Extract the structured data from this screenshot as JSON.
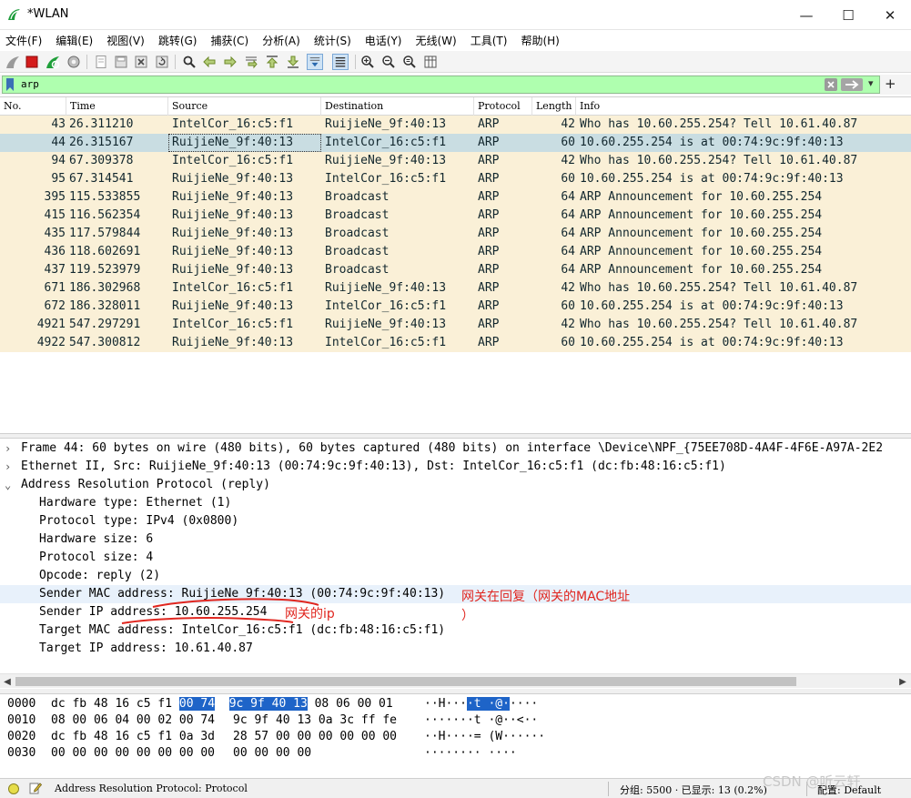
{
  "window": {
    "title": "*WLAN",
    "controls": {
      "minimize": "—",
      "maximize": "☐",
      "close": "✕"
    }
  },
  "menu": [
    "文件(F)",
    "编辑(E)",
    "视图(V)",
    "跳转(G)",
    "捕获(C)",
    "分析(A)",
    "统计(S)",
    "电话(Y)",
    "无线(W)",
    "工具(T)",
    "帮助(H)"
  ],
  "toolbar": {
    "icons": [
      "shark-fin-start-icon",
      "stop-capture-icon",
      "restart-capture-icon",
      "capture-options-icon",
      "open-file-icon",
      "save-file-icon",
      "close-file-icon",
      "reload-file-icon",
      "find-packet-icon",
      "go-back-icon",
      "go-forward-icon",
      "go-to-packet-icon",
      "go-first-icon",
      "go-last-icon",
      "auto-scroll-icon",
      "colorize-icon",
      "zoom-in-icon",
      "zoom-out-icon",
      "zoom-normal-icon",
      "resize-columns-icon"
    ]
  },
  "filter": {
    "value": "arp",
    "dropdown": "▾",
    "add": "+"
  },
  "packet_list": {
    "columns": [
      "No.",
      "Time",
      "Source",
      "Destination",
      "Protocol",
      "Length",
      "Info"
    ],
    "rows": [
      {
        "no": "43",
        "time": "26.311210",
        "source": "IntelCor_16:c5:f1",
        "destination": "RuijieNe_9f:40:13",
        "protocol": "ARP",
        "length": "42",
        "info": "Who has 10.60.255.254? Tell 10.61.40.87",
        "selected": false
      },
      {
        "no": "44",
        "time": "26.315167",
        "source": "RuijieNe_9f:40:13",
        "destination": "IntelCor_16:c5:f1",
        "protocol": "ARP",
        "length": "60",
        "info": "10.60.255.254 is at 00:74:9c:9f:40:13",
        "selected": true
      },
      {
        "no": "94",
        "time": "67.309378",
        "source": "IntelCor_16:c5:f1",
        "destination": "RuijieNe_9f:40:13",
        "protocol": "ARP",
        "length": "42",
        "info": "Who has 10.60.255.254? Tell 10.61.40.87",
        "selected": false
      },
      {
        "no": "95",
        "time": "67.314541",
        "source": "RuijieNe_9f:40:13",
        "destination": "IntelCor_16:c5:f1",
        "protocol": "ARP",
        "length": "60",
        "info": "10.60.255.254 is at 00:74:9c:9f:40:13",
        "selected": false
      },
      {
        "no": "395",
        "time": "115.533855",
        "source": "RuijieNe_9f:40:13",
        "destination": "Broadcast",
        "protocol": "ARP",
        "length": "64",
        "info": "ARP Announcement for 10.60.255.254",
        "selected": false
      },
      {
        "no": "415",
        "time": "116.562354",
        "source": "RuijieNe_9f:40:13",
        "destination": "Broadcast",
        "protocol": "ARP",
        "length": "64",
        "info": "ARP Announcement for 10.60.255.254",
        "selected": false
      },
      {
        "no": "435",
        "time": "117.579844",
        "source": "RuijieNe_9f:40:13",
        "destination": "Broadcast",
        "protocol": "ARP",
        "length": "64",
        "info": "ARP Announcement for 10.60.255.254",
        "selected": false
      },
      {
        "no": "436",
        "time": "118.602691",
        "source": "RuijieNe_9f:40:13",
        "destination": "Broadcast",
        "protocol": "ARP",
        "length": "64",
        "info": "ARP Announcement for 10.60.255.254",
        "selected": false
      },
      {
        "no": "437",
        "time": "119.523979",
        "source": "RuijieNe_9f:40:13",
        "destination": "Broadcast",
        "protocol": "ARP",
        "length": "64",
        "info": "ARP Announcement for 10.60.255.254",
        "selected": false
      },
      {
        "no": "671",
        "time": "186.302968",
        "source": "IntelCor_16:c5:f1",
        "destination": "RuijieNe_9f:40:13",
        "protocol": "ARP",
        "length": "42",
        "info": "Who has 10.60.255.254? Tell 10.61.40.87",
        "selected": false
      },
      {
        "no": "672",
        "time": "186.328011",
        "source": "RuijieNe_9f:40:13",
        "destination": "IntelCor_16:c5:f1",
        "protocol": "ARP",
        "length": "60",
        "info": "10.60.255.254 is at 00:74:9c:9f:40:13",
        "selected": false
      },
      {
        "no": "4921",
        "time": "547.297291",
        "source": "IntelCor_16:c5:f1",
        "destination": "RuijieNe_9f:40:13",
        "protocol": "ARP",
        "length": "42",
        "info": "Who has 10.60.255.254? Tell 10.61.40.87",
        "selected": false
      },
      {
        "no": "4922",
        "time": "547.300812",
        "source": "RuijieNe_9f:40:13",
        "destination": "IntelCor_16:c5:f1",
        "protocol": "ARP",
        "length": "60",
        "info": "10.60.255.254 is at 00:74:9c:9f:40:13",
        "selected": false
      }
    ]
  },
  "details": {
    "frame": "Frame 44: 60 bytes on wire (480 bits), 60 bytes captured (480 bits) on interface \\Device\\NPF_{75EE708D-4A4F-4F6E-A97A-2E2",
    "ethernet": "Ethernet II, Src: RuijieNe_9f:40:13 (00:74:9c:9f:40:13), Dst: IntelCor_16:c5:f1 (dc:fb:48:16:c5:f1)",
    "arp": "Address Resolution Protocol (reply)",
    "arp_fields": [
      "Hardware type: Ethernet (1)",
      "Protocol type: IPv4 (0x0800)",
      "Hardware size: 6",
      "Protocol size: 4",
      "Opcode: reply (2)",
      "Sender MAC address: RuijieNe_9f:40:13 (00:74:9c:9f:40:13)",
      "Sender IP address: 10.60.255.254",
      "Target MAC address: IntelCor_16:c5:f1 (dc:fb:48:16:c5:f1)",
      "Target IP address: 10.61.40.87"
    ],
    "expand_collapsed": "›",
    "expand_open": "⌄"
  },
  "annotations": {
    "mac_note_line1": "网关在回复（网关的MAC地址",
    "mac_note_line2": "）",
    "ip_note": "网关的ip",
    "color": "#e0261f"
  },
  "bytes": {
    "rows": [
      {
        "offset": "0000",
        "hex_a": "dc fb 48 16 c5 f1 ",
        "hex_sel1": "00 74",
        "hex_mid": "  ",
        "hex_sel2": "9c 9f 40 13",
        "hex_b": " 08 06 00 01",
        "ascii_a": "··H···",
        "ascii_sel": "·t ·@·",
        "ascii_b": "····"
      },
      {
        "offset": "0010",
        "hex1": "08 00 06 04 00 02 00 74",
        "hex2": "9c 9f 40 13 0a 3c ff fe",
        "ascii": "·······t ·@··<··"
      },
      {
        "offset": "0020",
        "hex1": "dc fb 48 16 c5 f1 0a 3d",
        "hex2": "28 57 00 00 00 00 00 00",
        "ascii": "··H····= (W······"
      },
      {
        "offset": "0030",
        "hex1": "00 00 00 00 00 00 00 00",
        "hex2": "00 00 00 00",
        "ascii": "········ ····"
      }
    ]
  },
  "status": {
    "protocol_text": "Address Resolution Protocol: Protocol",
    "packets_text": "分组: 5500 · 已显示: 13 (0.2%)",
    "profile_text": "配置: Default",
    "watermark": "CSDN @听云轩"
  },
  "colors": {
    "row_bg": "#faf0d7",
    "row_selected_bg": "#c9dde2",
    "filter_bg": "#afffaf",
    "byte_selected_bg": "#1e64c8"
  }
}
